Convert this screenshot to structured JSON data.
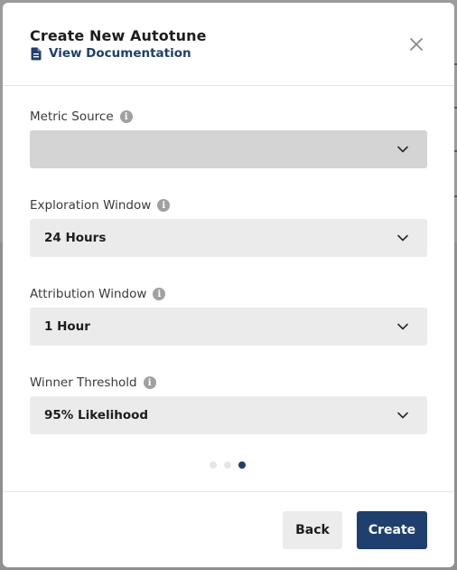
{
  "modal": {
    "title": "Create New Autotune",
    "doc_link": "View Documentation",
    "close_icon": "close-icon"
  },
  "fields": [
    {
      "label": "Metric Source",
      "value": "",
      "state": "disabled"
    },
    {
      "label": "Exploration Window",
      "value": "24 Hours",
      "state": "enabled"
    },
    {
      "label": "Attribution Window",
      "value": "1 Hour",
      "state": "enabled"
    },
    {
      "label": "Winner Threshold",
      "value": "95% Likelihood",
      "state": "enabled"
    }
  ],
  "info_icon_glyph": "i",
  "pagination": {
    "total": 3,
    "current": 3
  },
  "footer": {
    "back_label": "Back",
    "create_label": "Create"
  },
  "colors": {
    "primary": "#1f3f6e",
    "select_bg": "#ebebeb",
    "select_disabled_bg": "#d4d4d4"
  }
}
